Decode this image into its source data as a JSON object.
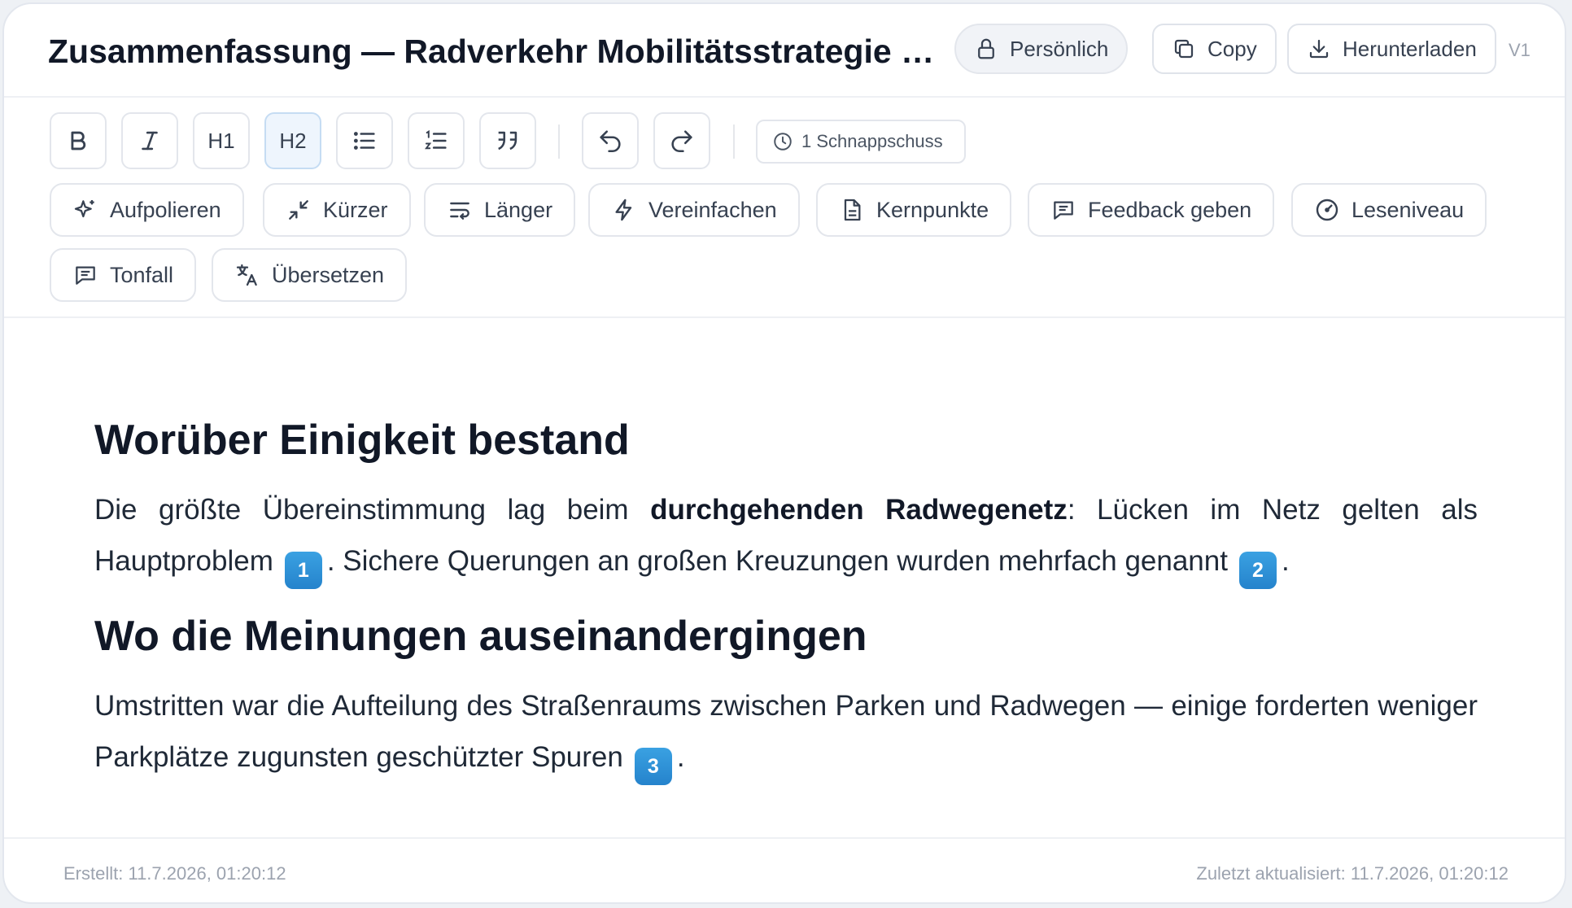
{
  "header": {
    "title": "Zusammenfassung — Radverkehr Mobilitätsstrategie Bürgerbeteiligung",
    "visibility_label": "Persönlich",
    "copy_label": "Copy",
    "download_label": "Herunterladen",
    "version": "V1"
  },
  "toolbar": {
    "h1_label": "H1",
    "h2_label": "H2",
    "snapshot_label": "1 Schnappschuss"
  },
  "actions": {
    "polish": "Aufpolieren",
    "shorter": "Kürzer",
    "longer": "Länger",
    "simplify": "Vereinfachen",
    "keypoints": "Kernpunkte",
    "feedback": "Feedback geben",
    "reading_level": "Leseniveau",
    "tone": "Tonfall",
    "translate": "Übersetzen"
  },
  "content": {
    "section1": {
      "heading": "Worüber Einigkeit bestand",
      "p_before": "Die größte Übereinstimmung lag beim ",
      "p_bold": "durchgehenden Radwegenetz",
      "p_mid1": ": Lücken im Netz gelten als Hauptproblem",
      "cite1": "1",
      "p_mid2": ". Sichere Querungen an großen Kreuzungen wurden mehrfach genannt",
      "cite2": "2",
      "p_end": "."
    },
    "section2": {
      "heading": "Wo die Meinungen auseinandergingen",
      "p_text": "Umstritten war die Aufteilung des Straßenraums zwischen Parken und Radwegen — einige forderten weniger Parkplätze zugunsten geschützter Spuren",
      "cite3": "3",
      "p_end": "."
    }
  },
  "footer": {
    "created": "Erstellt: 11.7.2026, 01:20:12",
    "updated": "Zuletzt aktualisiert: 11.7.2026, 01:20:12"
  },
  "colors": {
    "accent": "#2a8fd6",
    "active_bg": "#eef5fd",
    "text": "#111827",
    "muted": "#9ca3af"
  }
}
